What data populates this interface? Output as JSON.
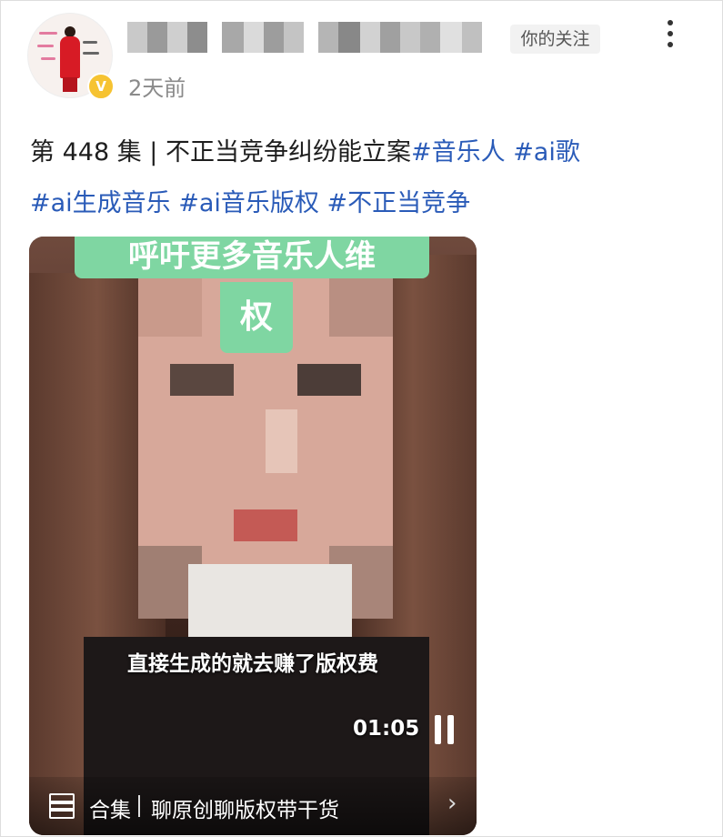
{
  "header": {
    "time_ago": "2天前",
    "follow_label": "你的关注"
  },
  "post": {
    "text_plain": "第 448 集 | 不正当竞争纠纷能立案",
    "tags": [
      "#音乐人",
      "#ai歌",
      "#ai生成音乐",
      "#ai音乐版权",
      "#不正当竞争"
    ]
  },
  "video": {
    "banner_line1": "呼吁更多音乐人维",
    "banner_line2": "权",
    "subtitle": "直接生成的就去赚了版权费",
    "duration": "01:05",
    "collection_label": "合集",
    "collection_name": "聊原创聊版权带干货"
  },
  "colors": {
    "tag": "#2a5bb8",
    "banner": "#7fd6a2",
    "verify_badge": "#f6c332"
  },
  "icons": [
    "more-vertical-icon",
    "verified-badge-icon",
    "pause-icon",
    "stack-icon",
    "chevron-right-icon"
  ]
}
